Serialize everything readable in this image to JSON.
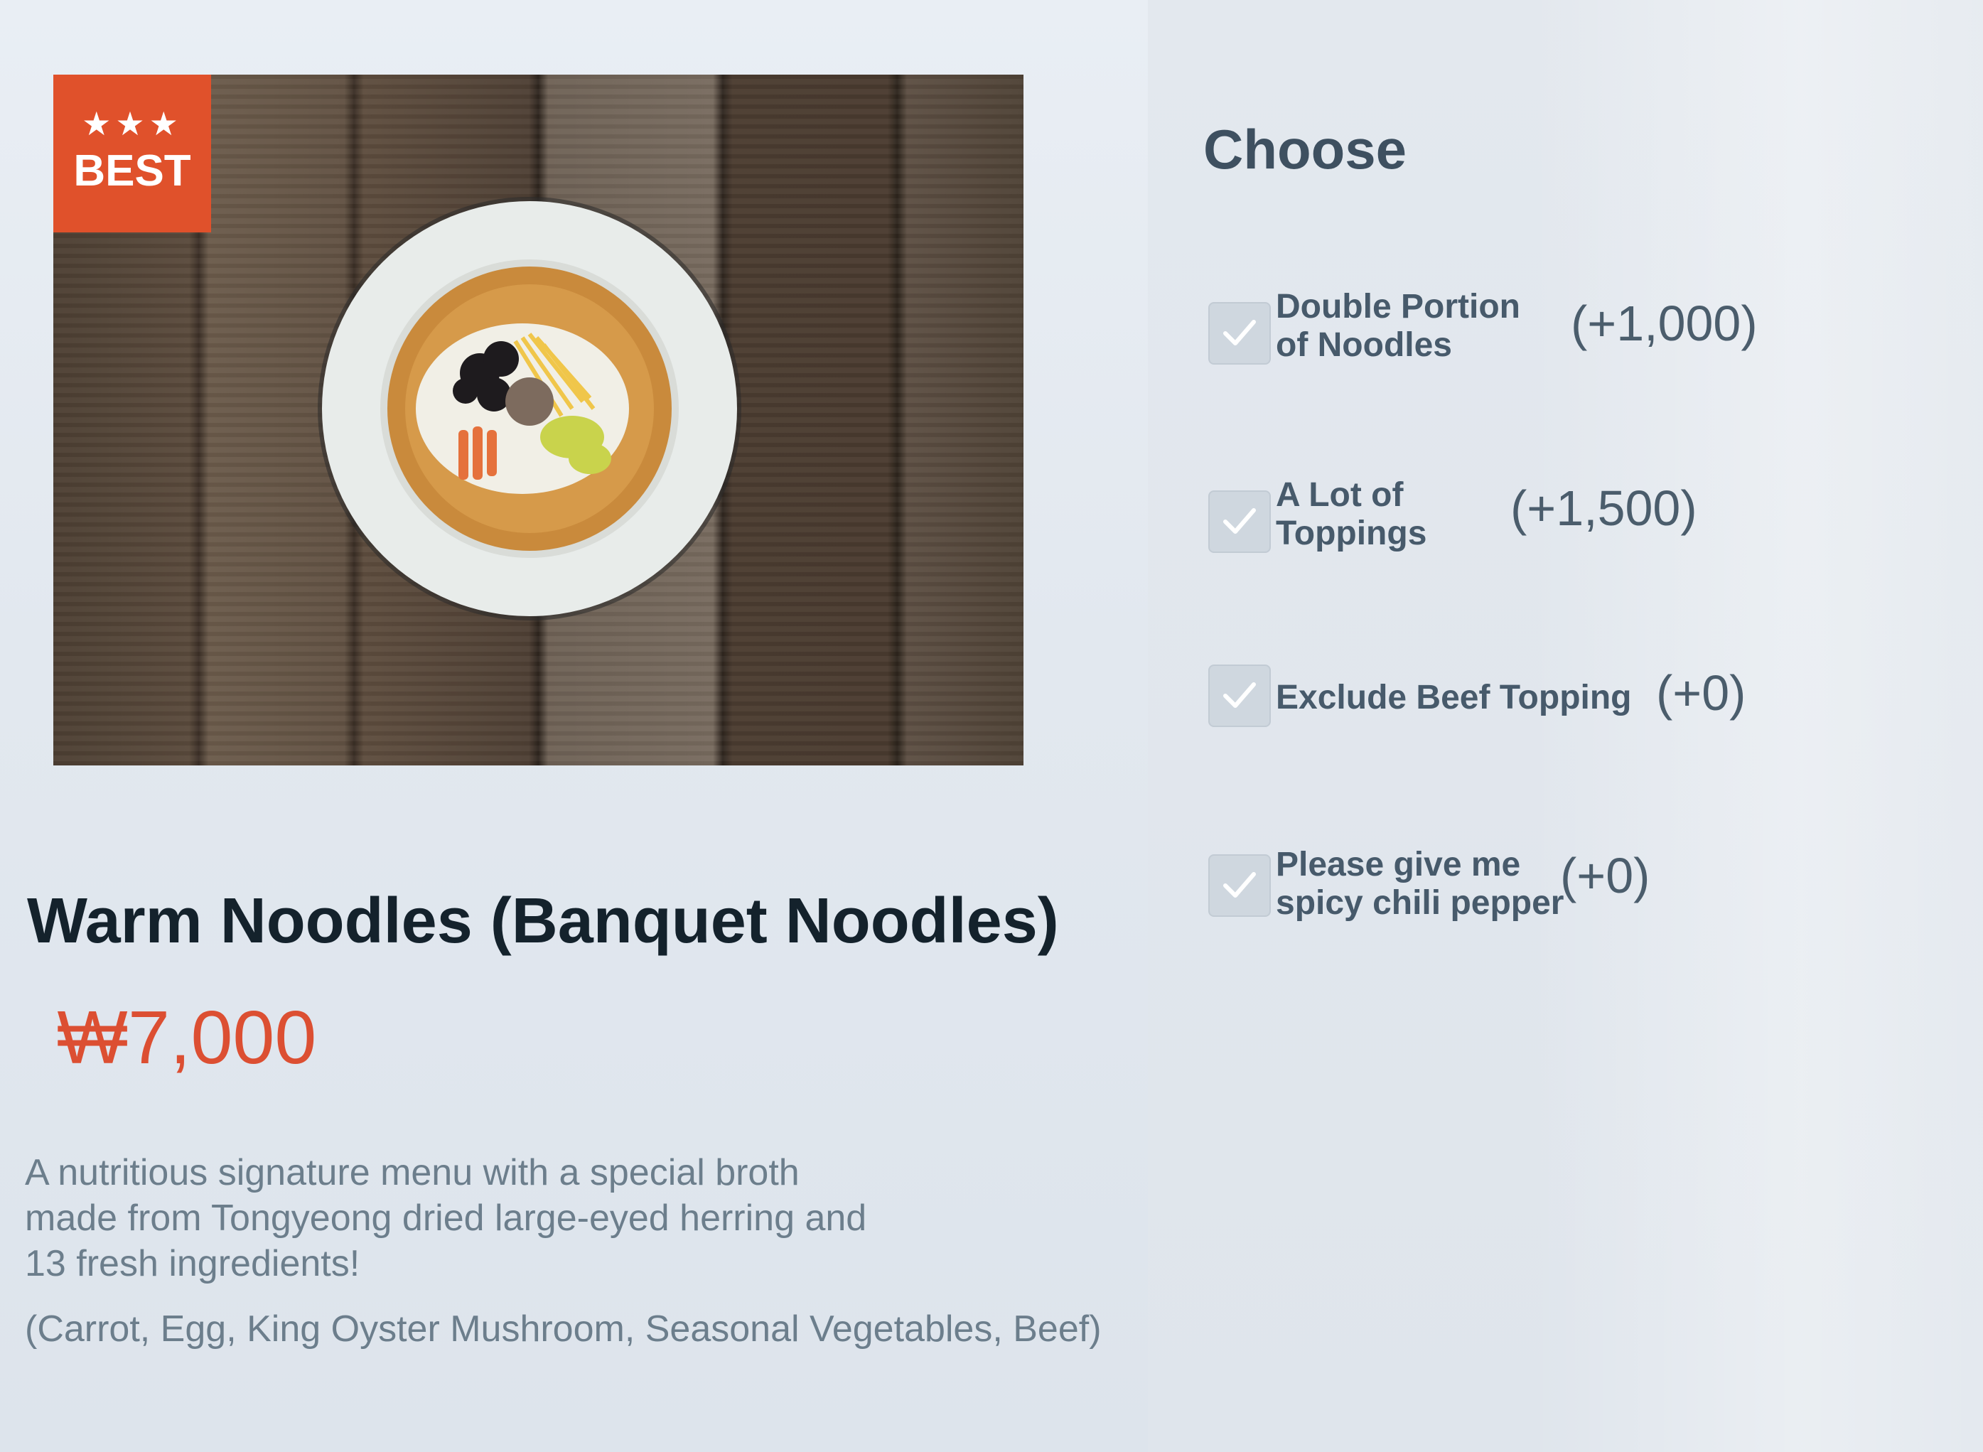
{
  "badge": {
    "stars": "★★★",
    "text": "BEST"
  },
  "product": {
    "name": "Warm Noodles (Banquet Noodles)",
    "price": "₩7,000",
    "description": "A nutritious signature menu with a special broth made from Tongyeong dried large-eyed herring and 13 fresh ingredients!",
    "ingredients": "(Carrot, Egg, King Oyster Mushroom, Seasonal Vegetables, Beef)"
  },
  "options": {
    "title": "Choose",
    "items": [
      {
        "label_line1": "Double Portion",
        "label_line2": "of Noodles",
        "price": "(+1,000)"
      },
      {
        "label_line1": "A Lot of",
        "label_line2": "Toppings",
        "price": "(+1,500)"
      },
      {
        "label_line1": "Exclude Beef Topping",
        "label_line2": "",
        "price": "(+0)"
      },
      {
        "label_line1": "Please give me",
        "label_line2": "spicy chili pepper",
        "price": "(+0)"
      }
    ]
  },
  "colors": {
    "accent": "#e0512b",
    "price": "#dc4f32",
    "title": "#14222c",
    "muted_text": "#6c7e8c"
  },
  "icons": [
    "star-icon",
    "check-icon"
  ]
}
